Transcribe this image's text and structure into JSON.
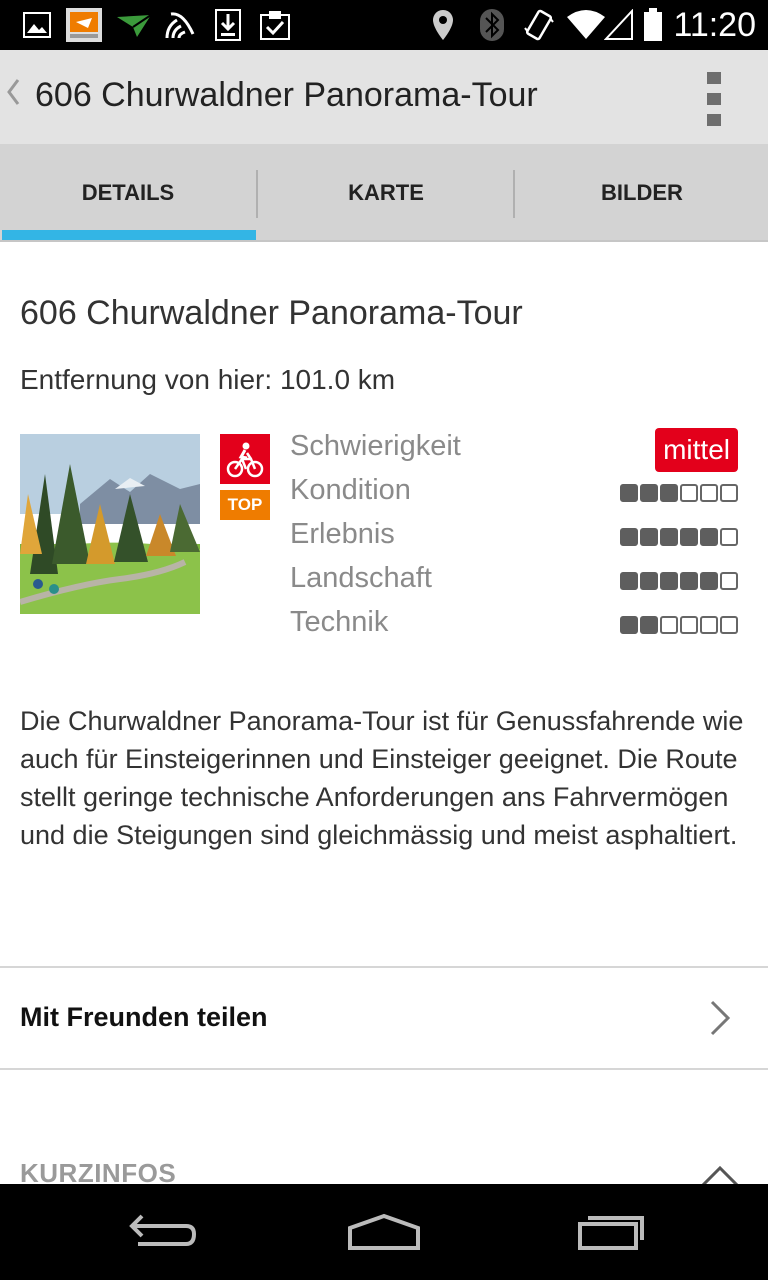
{
  "status_bar": {
    "time": "11:20",
    "left_icons": [
      "image-icon",
      "app-notification-icon",
      "signal-arrow-icon",
      "nfc-icon",
      "download-icon",
      "clipboard-check-icon"
    ],
    "right_icons": [
      "location-icon",
      "bluetooth-icon",
      "vibrate-icon",
      "wifi-icon",
      "cell-signal-icon",
      "battery-icon"
    ]
  },
  "action_bar": {
    "back_icon": "chevron-left-icon",
    "title": "606 Churwaldner Panorama-Tour",
    "overflow_icon": "more-vert-icon"
  },
  "tabs": [
    {
      "label": "DETAILS",
      "selected": true
    },
    {
      "label": "KARTE",
      "selected": false
    },
    {
      "label": "BILDER",
      "selected": false
    }
  ],
  "details": {
    "title": "606 Churwaldner Panorama-Tour",
    "distance": "Entfernung von hier: 101.0 km",
    "badges": {
      "bike_icon": "mountain-bike-icon",
      "top_label": "TOP"
    },
    "difficulty": {
      "label": "Schwierigkeit",
      "value": "mittel"
    },
    "ratings": [
      {
        "label": "Kondition",
        "value": 3,
        "max": 6
      },
      {
        "label": "Erlebnis",
        "value": 5,
        "max": 6
      },
      {
        "label": "Landschaft",
        "value": 5,
        "max": 6
      },
      {
        "label": "Technik",
        "value": 2,
        "max": 6
      }
    ],
    "description": "Die Churwaldner Panorama-Tour ist für Genussfahrende wie auch für Einsteigerinnen und Einsteiger geeignet. Die Route stellt geringe technische Anforderungen ans Fahrvermögen und die Steigungen sind gleichmässig und meist asphaltiert."
  },
  "share": {
    "label": "Mit Freunden teilen",
    "icon": "chevron-right-icon"
  },
  "kurzinfos": {
    "label": "KURZINFOS",
    "icon": "chevron-up-icon"
  },
  "nav_bar": {
    "buttons": [
      "back-icon",
      "home-icon",
      "recent-apps-icon"
    ]
  },
  "colors": {
    "accent": "#33b5e5",
    "difficulty_red": "#e3001b",
    "top_orange": "#ef7c00",
    "tab_background": "#d3d3d3",
    "action_bar_background": "#e3e3e3"
  }
}
